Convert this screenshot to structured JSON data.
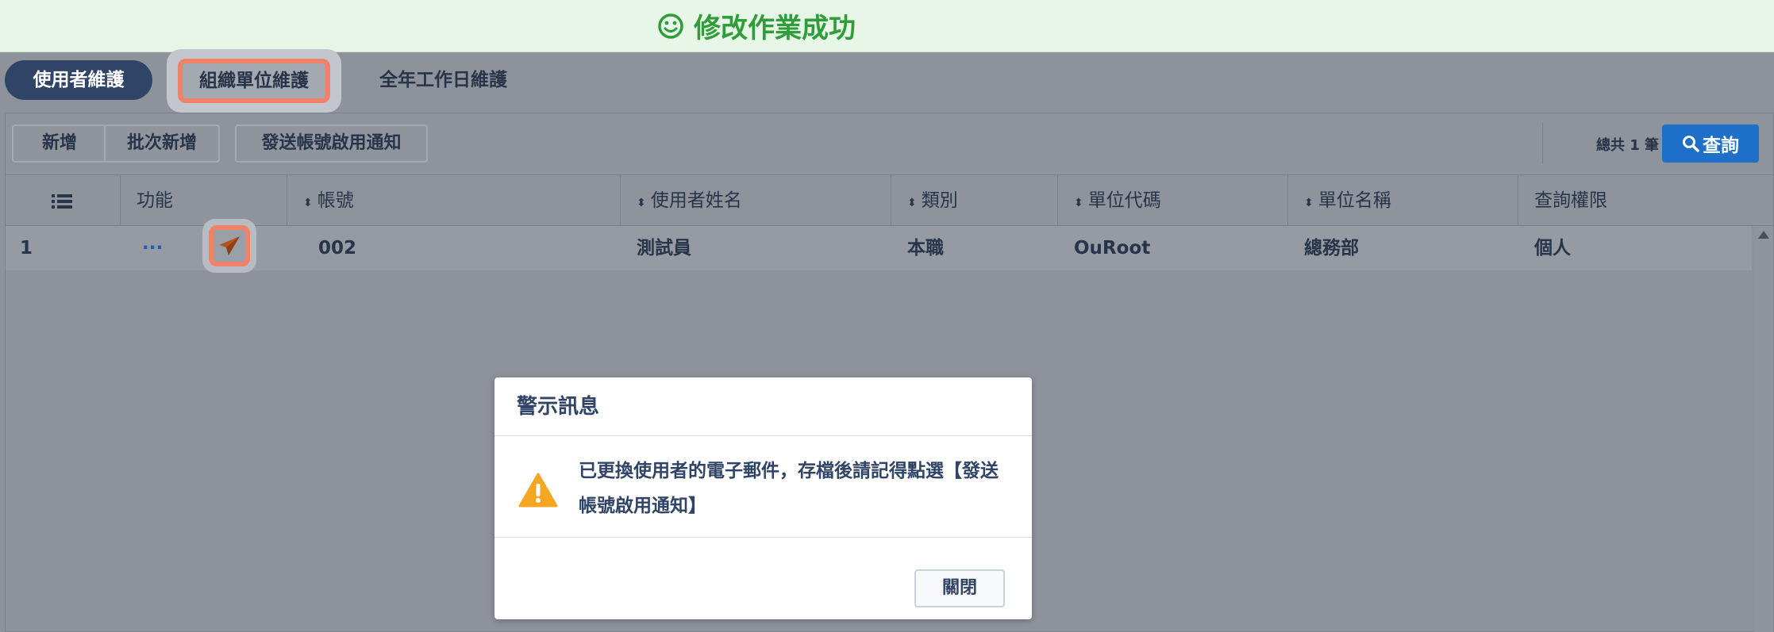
{
  "toast": {
    "message": "修改作業成功",
    "icon": "smile-icon"
  },
  "tabs": [
    {
      "label": "使用者維護",
      "active": true
    },
    {
      "label": "組織單位維護",
      "highlighted": true
    },
    {
      "label": "全年工作日維護"
    }
  ],
  "toolbar": {
    "add_label": "新增",
    "batch_add_label": "批次新增",
    "send_notice_label": "發送帳號啟用通知",
    "total_text": "總共 1 筆",
    "query_label": "查詢"
  },
  "table": {
    "headers": [
      "功能",
      "帳號",
      "使用者姓名",
      "類別",
      "單位代碼",
      "單位名稱",
      "查詢權限"
    ],
    "rows": [
      {
        "index": "1",
        "actions": "···",
        "account": "002",
        "name": "測試員",
        "category": "本職",
        "unit_code": "OuRoot",
        "unit_name": "總務部",
        "permission": "個人"
      }
    ]
  },
  "dialog": {
    "title": "警示訊息",
    "message": "已更換使用者的電子郵件，存檔後請記得點選【發送帳號啟用通知】",
    "close_label": "關閉"
  },
  "colors": {
    "accent": "#1d6fc8",
    "success": "#2f9d3a",
    "highlight": "#f0826a",
    "warning": "#f5a623"
  }
}
